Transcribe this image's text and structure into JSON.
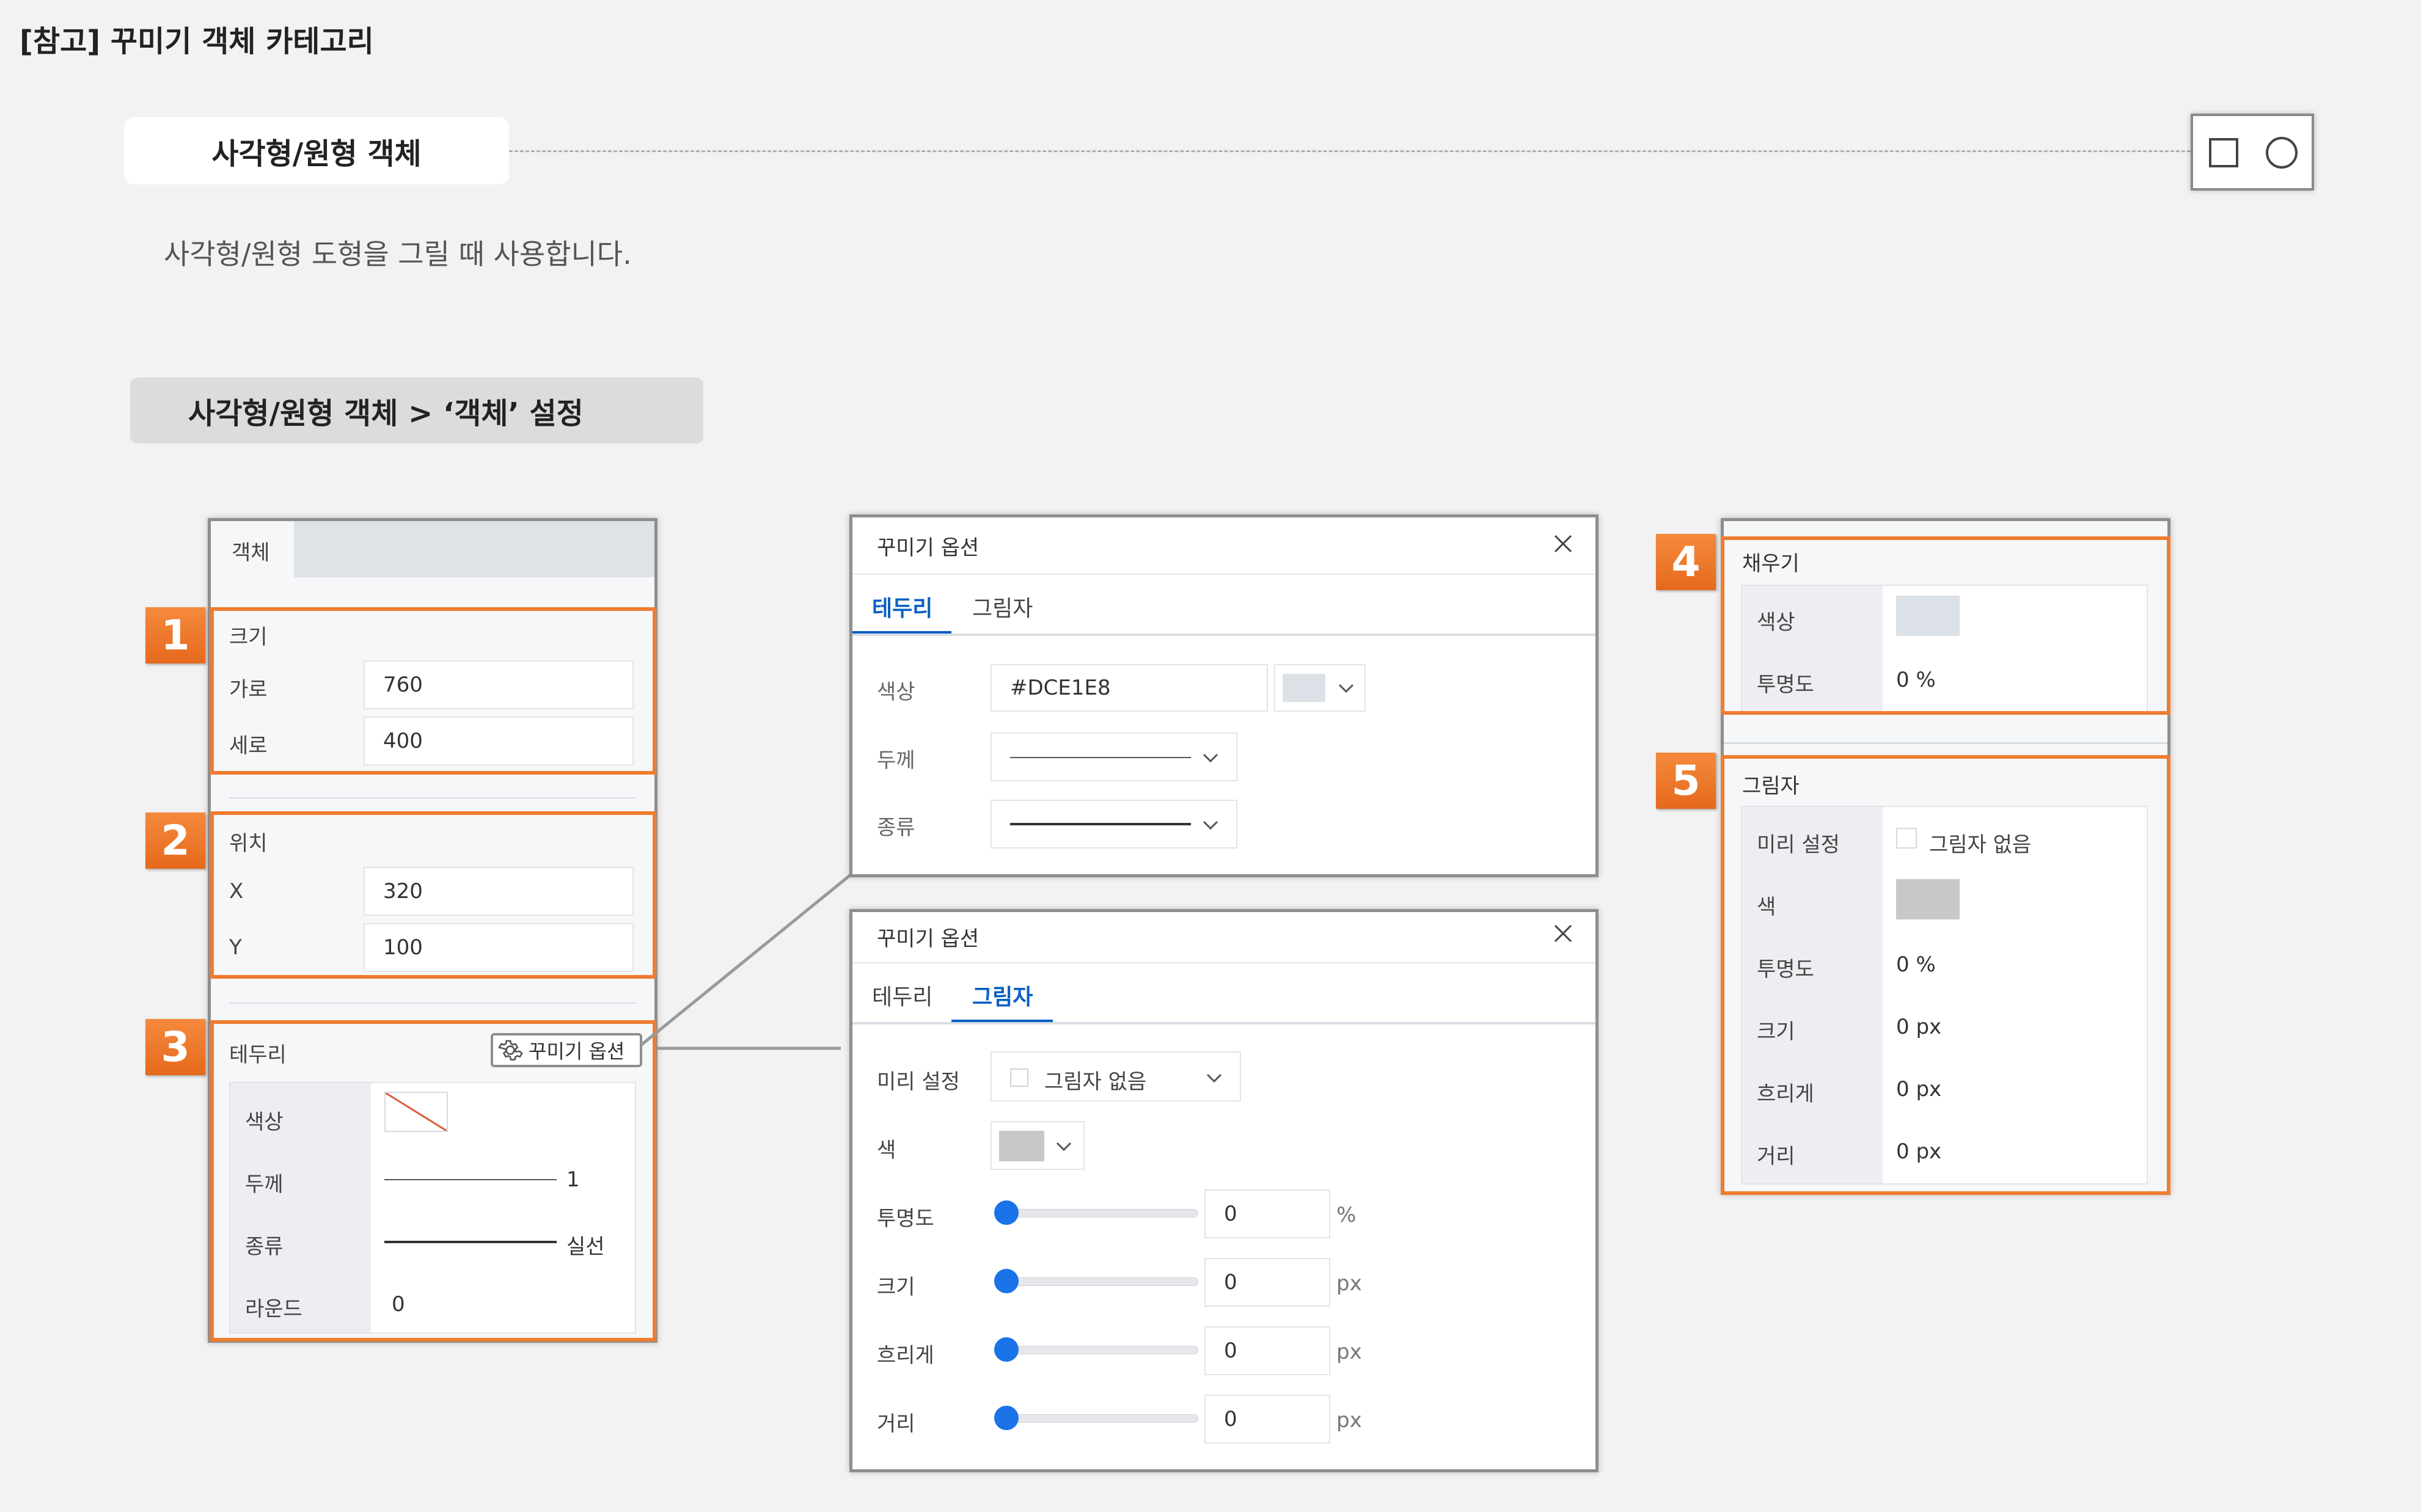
{
  "page_title": "[참고] 꾸미기 객체 카테고리",
  "section": {
    "tag": "사각형/원형 객체",
    "description": "사각형/원형 도형을 그릴 때 사용합니다.",
    "sub_tag": "사각형/원형 객체 > ‘객체’ 설정"
  },
  "left_panel": {
    "tab": "객체",
    "size": {
      "label": "크기",
      "width_label": "가로",
      "width_value": "760",
      "height_label": "세로",
      "height_value": "400"
    },
    "position": {
      "label": "위치",
      "x_label": "X",
      "x_value": "320",
      "y_label": "Y",
      "y_value": "100"
    },
    "border": {
      "label": "테두리",
      "options_button": "꾸미기 옵션",
      "color_label": "색상",
      "thickness_label": "두께",
      "thickness_value": "1",
      "type_label": "종류",
      "type_value": "실선",
      "round_label": "라운드",
      "round_value": "0"
    }
  },
  "badges": [
    "1",
    "2",
    "3",
    "4",
    "5"
  ],
  "dialog_border": {
    "title": "꾸미기 옵션",
    "tabs": [
      "테두리",
      "그림자"
    ],
    "color_label": "색상",
    "color_value": "#DCE1E8",
    "swatch_color": "#DCE1E8",
    "thickness_label": "두께",
    "type_label": "종류"
  },
  "dialog_shadow": {
    "title": "꾸미기 옵션",
    "tabs": [
      "테두리",
      "그림자"
    ],
    "preset_label": "미리 설정",
    "preset_value": "그림자 없음",
    "color_label": "색",
    "opacity_label": "투명도",
    "opacity_value": "0",
    "opacity_unit": "%",
    "size_label": "크기",
    "size_value": "0",
    "size_unit": "px",
    "blur_label": "흐리게",
    "blur_value": "0",
    "blur_unit": "px",
    "distance_label": "거리",
    "distance_value": "0",
    "distance_unit": "px"
  },
  "right_panel": {
    "fill": {
      "label": "채우기",
      "color_label": "색상",
      "swatch_color": "#DCE1E8",
      "opacity_label": "투명도",
      "opacity_value": "0 %"
    },
    "shadow": {
      "label": "그림자",
      "preset_label": "미리 설정",
      "preset_value": "그림자 없음",
      "color_label": "색",
      "swatch_color": "#C8C8C8",
      "opacity_label": "투명도",
      "opacity_value": "0 %",
      "size_label": "크기",
      "size_value": "0 px",
      "blur_label": "흐리게",
      "blur_value": "0 px",
      "distance_label": "거리",
      "distance_value": "0 px"
    }
  },
  "colors": {
    "accent_orange": "#F07C30",
    "accent_blue": "#0A5FC4",
    "slider_blue": "#1A73E8"
  }
}
